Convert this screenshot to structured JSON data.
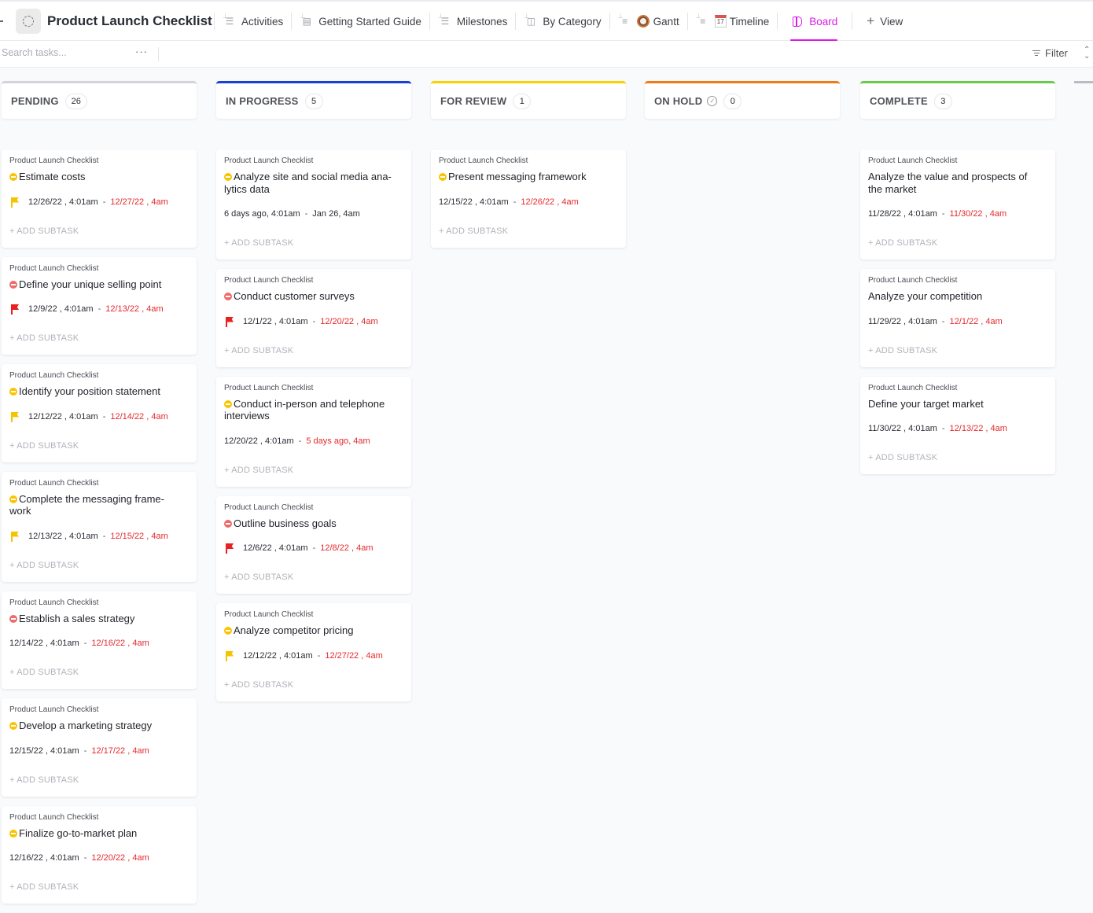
{
  "header": {
    "title": "Product Launch Checklist",
    "tabs": [
      {
        "label": "Activities",
        "icon": "list-icon",
        "active": false
      },
      {
        "label": "Getting Started Guide",
        "icon": "doc-icon",
        "active": false
      },
      {
        "label": "Milestones",
        "icon": "list-icon",
        "active": false
      },
      {
        "label": "By Category",
        "icon": "board-icon",
        "active": false
      },
      {
        "label": "Gantt",
        "icon": "clock-emoji-icon",
        "active": false
      },
      {
        "label": "Timeline",
        "icon": "calendar-emoji-icon",
        "active": false
      },
      {
        "label": "Board",
        "icon": "board-icon",
        "active": true
      },
      {
        "label": "View",
        "icon": "plus-icon",
        "active": false
      }
    ],
    "calendar_emoji_day": "17"
  },
  "toolbar": {
    "search_placeholder": "Search tasks...",
    "more_label": "···",
    "filter_label": "Filter"
  },
  "colors": {
    "accent": "#e017e6",
    "overdue": "#e5292d",
    "flag_high": "#ea1f1f",
    "flag_normal": "#f5c400",
    "status_yellow": "#fbc300",
    "status_red": "#ee6b6b"
  },
  "common": {
    "list_name": "Product Launch Checklist",
    "add_subtask": "+ ADD SUBTASK",
    "date_separator": "-"
  },
  "columns": [
    {
      "title": "PENDING",
      "count": "26",
      "color": "#d3d5d9",
      "cards": [
        {
          "title": "Estimate costs",
          "status": "yellow",
          "flag": "yellow",
          "start": "12/26/22 , 4:01am",
          "due": "12/27/22 , 4am",
          "due_overdue": true
        },
        {
          "title": "Define your unique selling point",
          "status": "red",
          "flag": "red",
          "start": "12/9/22 , 4:01am",
          "due": "12/13/22 , 4am",
          "due_overdue": true
        },
        {
          "title": "Identify your position statement",
          "status": "yellow",
          "flag": "yellow",
          "start": "12/12/22 , 4:01am",
          "due": "12/14/22 , 4am",
          "due_overdue": true
        },
        {
          "title": "Complete the messaging frame-work",
          "status": "yellow",
          "flag": "yellow",
          "start": "12/13/22 , 4:01am",
          "due": "12/15/22 , 4am",
          "due_overdue": true
        },
        {
          "title": "Establish a sales strategy",
          "status": "red",
          "flag": null,
          "start": "12/14/22 , 4:01am",
          "due": "12/16/22 , 4am",
          "due_overdue": true
        },
        {
          "title": "Develop a marketing strategy",
          "status": "yellow",
          "flag": null,
          "start": "12/15/22 , 4:01am",
          "due": "12/17/22 , 4am",
          "due_overdue": true
        },
        {
          "title": "Finalize go-to-market plan",
          "status": "yellow",
          "flag": null,
          "start": "12/16/22 , 4:01am",
          "due": "12/20/22 , 4am",
          "due_overdue": true
        }
      ]
    },
    {
      "title": "IN PROGRESS",
      "count": "5",
      "color": "#1a3fd9",
      "cards": [
        {
          "title": "Analyze site and social media ana-lytics data",
          "status": "yellow",
          "flag": null,
          "start": "6 days ago, 4:01am",
          "due": "Jan 26, 4am",
          "due_overdue": false
        },
        {
          "title": "Conduct customer surveys",
          "status": "red",
          "flag": "red",
          "start": "12/1/22 , 4:01am",
          "due": "12/20/22 , 4am",
          "due_overdue": true
        },
        {
          "title": "Conduct in-person and telephone interviews",
          "status": "yellow",
          "flag": null,
          "start": "12/20/22 , 4:01am",
          "due": "5 days ago, 4am",
          "due_overdue": true
        },
        {
          "title": "Outline business goals",
          "status": "red",
          "flag": "red",
          "start": "12/6/22 , 4:01am",
          "due": "12/8/22 , 4am",
          "due_overdue": true
        },
        {
          "title": "Analyze competitor pricing",
          "status": "yellow",
          "flag": "yellow",
          "start": "12/12/22 , 4:01am",
          "due": "12/27/22 , 4am",
          "due_overdue": true
        }
      ]
    },
    {
      "title": "FOR REVIEW",
      "count": "1",
      "color": "#f7d200",
      "cards": [
        {
          "title": "Present messaging framework",
          "status": "yellow",
          "flag": null,
          "start": "12/15/22 , 4:01am",
          "due": "12/26/22 , 4am",
          "due_overdue": true
        }
      ]
    },
    {
      "title": "ON HOLD",
      "count": "0",
      "color": "#f07a1a",
      "has_done_icon": true,
      "cards": []
    },
    {
      "title": "COMPLETE",
      "count": "3",
      "color": "#6bc950",
      "cards": [
        {
          "title": "Analyze the value and prospects of the market",
          "status": null,
          "flag": null,
          "start": "11/28/22 , 4:01am",
          "due": "11/30/22 , 4am",
          "due_overdue": true
        },
        {
          "title": "Analyze your competition",
          "status": null,
          "flag": null,
          "start": "11/29/22 , 4:01am",
          "due": "12/1/22 , 4am",
          "due_overdue": true
        },
        {
          "title": "Define your target market",
          "status": null,
          "flag": null,
          "start": "11/30/22 , 4:01am",
          "due": "12/13/22 , 4am",
          "due_overdue": true
        }
      ]
    }
  ]
}
